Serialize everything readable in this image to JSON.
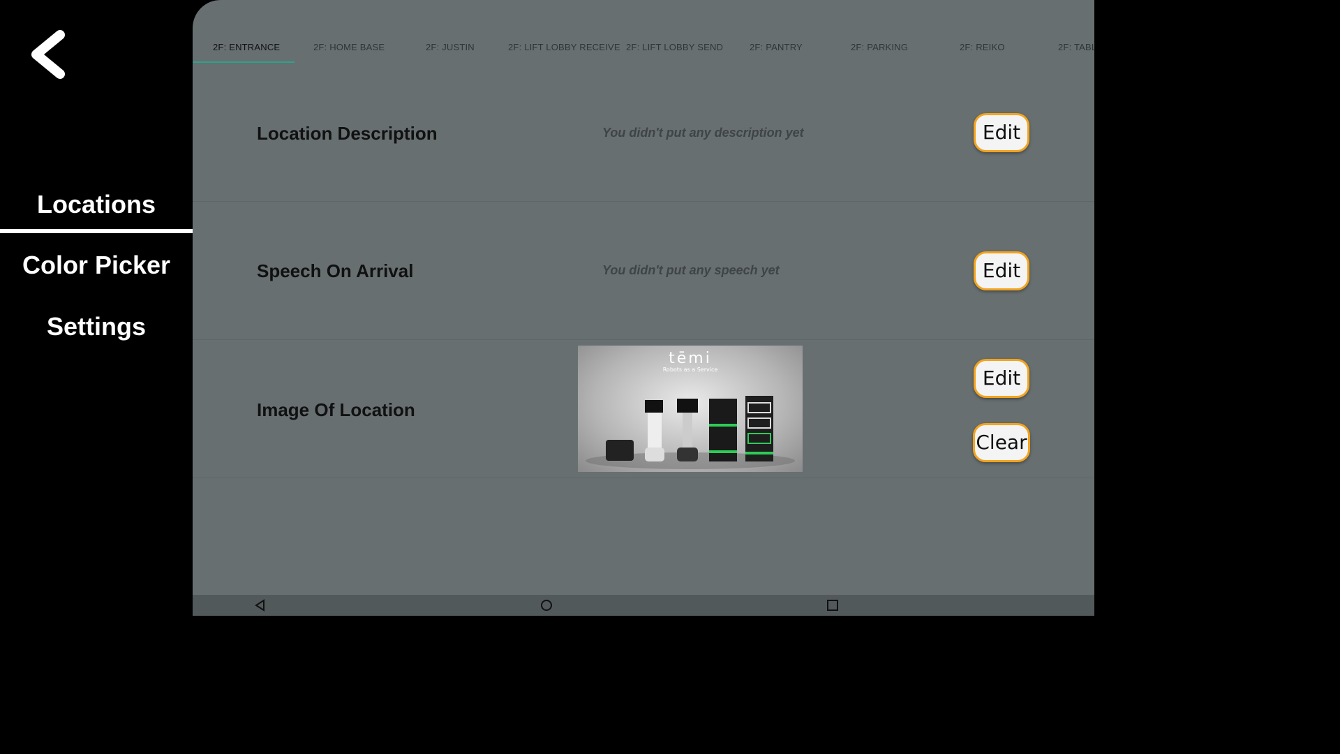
{
  "sidebar": {
    "back_icon": "chevron-left-icon",
    "items": [
      {
        "label": "Locations",
        "active": true
      },
      {
        "label": "Color Picker",
        "active": false
      },
      {
        "label": "Settings",
        "active": false
      }
    ]
  },
  "tabs": [
    {
      "label": "2F: ENTRANCE",
      "active": true
    },
    {
      "label": "2F: HOME BASE"
    },
    {
      "label": "2F: JUSTIN"
    },
    {
      "label": "2F: LIFT LOBBY RECEIVE"
    },
    {
      "label": "2F: LIFT LOBBY SEND"
    },
    {
      "label": "2F: PANTRY"
    },
    {
      "label": "2F: PARKING"
    },
    {
      "label": "2F: REIKO"
    },
    {
      "label": "2F: TABL"
    }
  ],
  "rows": {
    "description": {
      "label": "Location Description",
      "value": "You didn't put any description yet",
      "edit_label": "Edit"
    },
    "speech": {
      "label": "Speech On Arrival",
      "value": "You didn't put any speech yet",
      "edit_label": "Edit"
    },
    "image": {
      "label": "Image Of Location",
      "edit_label": "Edit",
      "clear_label": "Clear",
      "brand": "tēmi",
      "brand_sub": "Robots as a Service"
    }
  },
  "colors": {
    "panel": "#676f71",
    "accent_border": "#f3a41e",
    "tab_indicator": "#2aa58a"
  },
  "system_nav": {
    "back": "triangle-back-icon",
    "home": "circle-home-icon",
    "recents": "square-recents-icon"
  }
}
